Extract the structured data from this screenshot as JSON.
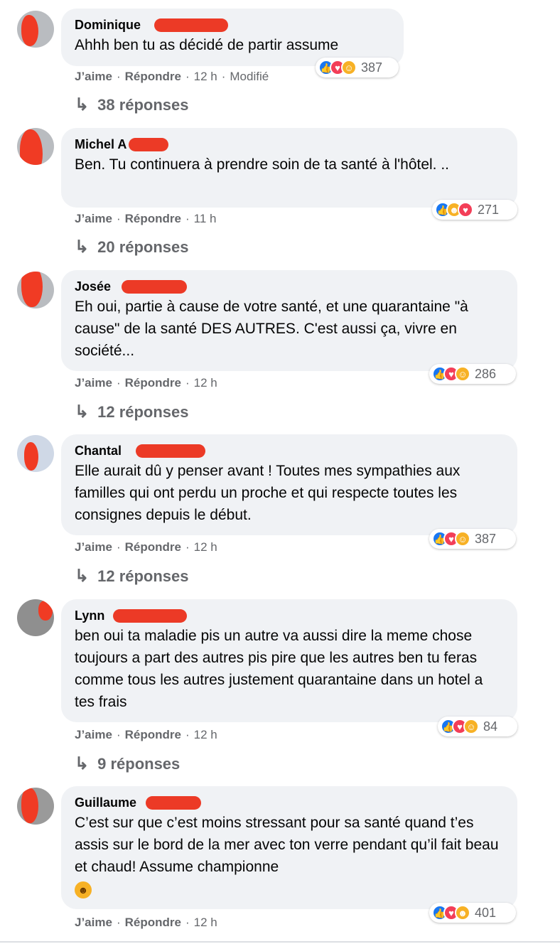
{
  "comments": [
    {
      "author": "Dominique",
      "text": "Ahhh ben tu as décidé de partir assume",
      "like_label": "J’aime",
      "reply_label": "Répondre",
      "time": "12 h",
      "edited": "Modifié",
      "reaction_count": "387",
      "reaction_icons": [
        "like-icon",
        "love-icon",
        "care-icon"
      ],
      "replies": "38 réponses"
    },
    {
      "author": "Michel A",
      "text": "Ben. Tu continuera à prendre soin de ta santé à l'hôtel. ..",
      "like_label": "J’aime",
      "reply_label": "Répondre",
      "time": "11 h",
      "reaction_count": "271",
      "reaction_icons": [
        "like-icon",
        "haha-icon",
        "love-icon"
      ],
      "replies": "20 réponses"
    },
    {
      "author": "Josée",
      "text": "Eh oui, partie à cause de votre santé, et une quarantaine \"à cause\" de la santé DES AUTRES. C'est aussi ça, vivre en société...",
      "like_label": "J’aime",
      "reply_label": "Répondre",
      "time": "12 h",
      "reaction_count": "286",
      "reaction_icons": [
        "like-icon",
        "love-icon",
        "care-icon"
      ],
      "replies": "12 réponses"
    },
    {
      "author": "Chantal",
      "text": "Elle aurait dû y penser avant ! Toutes mes sympathies aux familles qui ont perdu un proche et qui respecte toutes les consignes depuis le début.",
      "like_label": "J’aime",
      "reply_label": "Répondre",
      "time": "12 h",
      "reaction_count": "387",
      "reaction_icons": [
        "like-icon",
        "love-icon",
        "care-icon"
      ],
      "replies": "12 réponses"
    },
    {
      "author": "Lynn",
      "text": "ben oui ta maladie pis un autre va aussi dire la meme chose toujours a part des autres pis pire que les autres ben tu feras comme tous les autres justement quarantaine dans un hotel a tes frais",
      "like_label": "J’aime",
      "reply_label": "Répondre",
      "time": "12 h",
      "reaction_count": "84",
      "reaction_icons": [
        "like-icon",
        "love-icon",
        "care-icon"
      ],
      "replies": "9 réponses"
    },
    {
      "author": "Guillaume",
      "text": "C’est sur que c’est moins stressant pour sa santé quand t’es assis sur le bord de la mer avec ton verre pendant qu’il fait beau et chaud! Assume championne",
      "like_label": "J’aime",
      "reply_label": "Répondre",
      "time": "12 h",
      "reaction_count": "401",
      "reaction_icons": [
        "like-icon",
        "love-icon",
        "haha-icon"
      ],
      "inline_emoji": "laughing-emoji-icon"
    }
  ],
  "colors": {
    "bubble": "#f0f2f5",
    "meta_text": "#65676b",
    "like_blue": "#1877f2",
    "love_red": "#f33e58",
    "care_yellow": "#f7b125",
    "redaction_red": "#ec3a26"
  }
}
